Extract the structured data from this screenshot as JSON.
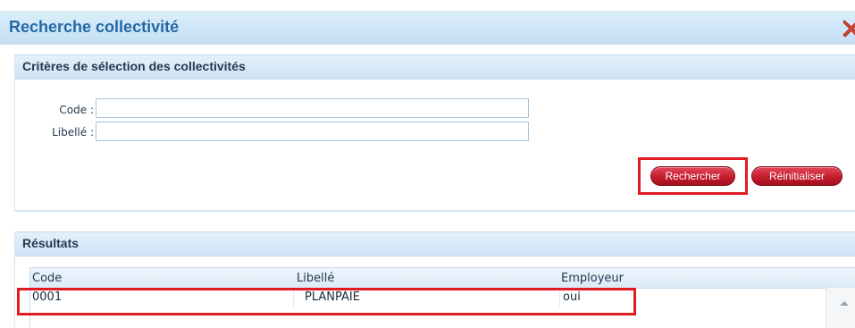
{
  "window": {
    "title": "Recherche collectivité"
  },
  "criteria": {
    "header": "Critères de sélection des collectivités",
    "code_label": "Code :",
    "code_value": "",
    "libelle_label": "Libellé :",
    "libelle_value": "",
    "search_button": "Rechercher",
    "reset_button": "Réinitialiser"
  },
  "results": {
    "header": "Résultats",
    "columns": [
      "Code",
      "Libellé",
      "Employeur"
    ],
    "rows": [
      [
        "0001",
        "PLANPAIE",
        "oui"
      ]
    ]
  },
  "colors": {
    "title": "#2369a6",
    "button": "#c41c2e",
    "highlight": "#e21b23",
    "header_bg": "#cde3f5"
  },
  "icons": {
    "close": "close-icon",
    "scroll_up": "scroll-up-arrow-icon"
  }
}
